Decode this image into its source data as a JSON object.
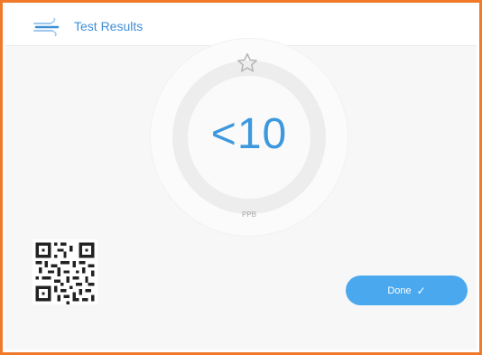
{
  "header": {
    "icon": "wind-flow-icon",
    "title": "Test Results"
  },
  "result": {
    "value": "<10",
    "unit": "PPB",
    "favorite_icon": "star-outline-icon"
  },
  "actions": {
    "done_label": "Done",
    "done_icon": "check-icon"
  },
  "colors": {
    "accent": "#3e98de",
    "button": "#4aa9ee",
    "frame": "#f07a2a"
  }
}
